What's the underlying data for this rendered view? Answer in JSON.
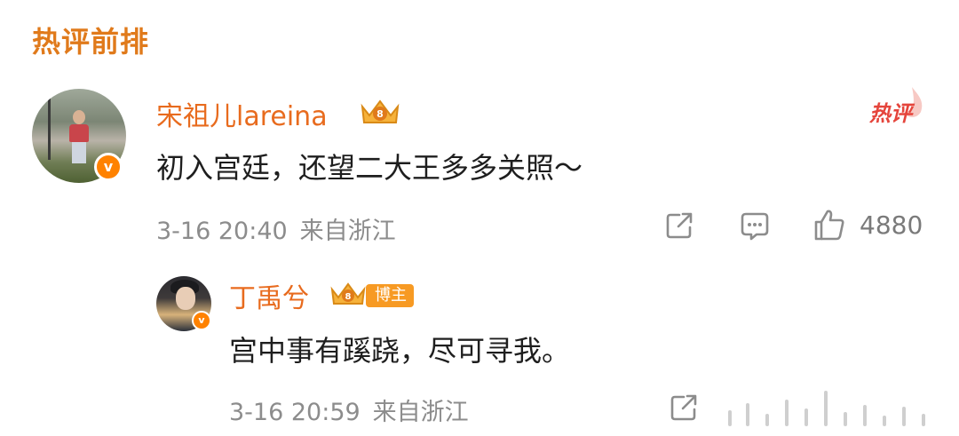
{
  "section_title": "热评前排",
  "hot_badge": "热评",
  "main_comment": {
    "username": "宋祖儿lareina",
    "text": "初入宫廷，还望二大王多多关照～",
    "date": "3-16 20:40",
    "location": "来自浙江",
    "likes": "4880",
    "verified_label": "v"
  },
  "reply": {
    "username": "丁禹兮",
    "badge": "博主",
    "text": "宫中事有蹊跷，尽可寻我。",
    "date": "3-16 20:59",
    "location": "来自浙江",
    "verified_label": "v"
  },
  "icons": {
    "share": "share-icon",
    "comment": "comment-icon",
    "like": "like-icon",
    "crown": "fan-crown-icon",
    "flame": "flame-icon",
    "verified": "verified-icon"
  },
  "colors": {
    "accent_orange": "#e86b1e",
    "title_orange": "#e07a1b",
    "hot_red": "#e5453c",
    "meta_gray": "#8c8c8c"
  }
}
